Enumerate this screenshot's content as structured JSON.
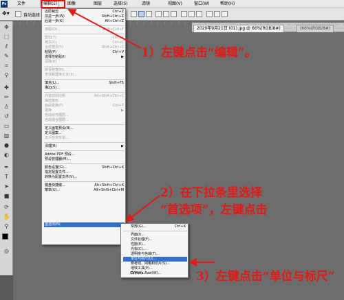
{
  "menubar": {
    "logo": "Ps",
    "items": [
      "文件",
      "编辑(E)",
      "图像",
      "图层",
      "选择(S)",
      "滤镜",
      "视图(V)",
      "窗口(W)",
      "帮助(H)"
    ]
  },
  "options_bar": {
    "auto_select": "自动选择",
    "move_icon": "move-tool-icon"
  },
  "document": {
    "tab_active": "2020年9月21日 (01).jpg @ 66%(RGB/8#)",
    "tab_inactive": "(66%(RGB/8#)"
  },
  "edit_menu": {
    "items": [
      {
        "label": "还原裁剪",
        "shortcut": "Ctrl+Z",
        "disabled": false
      },
      {
        "label": "前进一步(W)",
        "shortcut": "Shift+Ctrl+Z",
        "disabled": false
      },
      {
        "label": "后退一步(K)",
        "shortcut": "Alt+Ctrl+Z",
        "disabled": false
      },
      {
        "label": "渐隐(D)...",
        "shortcut": "Shift+Ctrl+F",
        "disabled": true
      },
      {
        "label": "剪切(T)",
        "shortcut": "Ctrl+X",
        "disabled": true
      },
      {
        "label": "拷贝(C)",
        "shortcut": "Ctrl+C",
        "disabled": true
      },
      {
        "label": "合并拷贝(Y)",
        "shortcut": "Shift+Ctrl+C",
        "disabled": true
      },
      {
        "label": "粘贴(P)",
        "shortcut": "Ctrl+V",
        "disabled": false
      },
      {
        "label": "选择性粘贴(I)",
        "shortcut": "",
        "disabled": false,
        "submenu": true
      },
      {
        "label": "清除(E)",
        "shortcut": "",
        "disabled": true
      },
      {
        "label": "拼写检查(H)...",
        "shortcut": "",
        "disabled": true
      },
      {
        "label": "查找和替换文本(X)...",
        "shortcut": "",
        "disabled": true
      },
      {
        "label": "填充(L)...",
        "shortcut": "Shift+F5",
        "disabled": false
      },
      {
        "label": "描边(S)...",
        "shortcut": "",
        "disabled": false
      },
      {
        "label": "内容识别比例",
        "shortcut": "Alt+Shift+Ctrl+C",
        "disabled": true
      },
      {
        "label": "操控变形",
        "shortcut": "",
        "disabled": true
      },
      {
        "label": "自由变换(F)",
        "shortcut": "Ctrl+T",
        "disabled": true
      },
      {
        "label": "变换",
        "shortcut": "",
        "disabled": true,
        "submenu": true
      },
      {
        "label": "自动对齐图层...",
        "shortcut": "",
        "disabled": true
      },
      {
        "label": "自动混合图层...",
        "shortcut": "",
        "disabled": true
      },
      {
        "label": "定义画笔预设(B)...",
        "shortcut": "",
        "disabled": false
      },
      {
        "label": "定义图案...",
        "shortcut": "",
        "disabled": false
      },
      {
        "label": "定义自定形状...",
        "shortcut": "",
        "disabled": true
      },
      {
        "label": "清理(R)",
        "shortcut": "",
        "disabled": false,
        "submenu": true
      },
      {
        "label": "Adobe PDF 预设...",
        "shortcut": "",
        "disabled": false
      },
      {
        "label": "预设管理器(M)...",
        "shortcut": "",
        "disabled": false
      },
      {
        "label": "颜色设置(G)...",
        "shortcut": "Shift+Ctrl+K",
        "disabled": false
      },
      {
        "label": "指定配置文件...",
        "shortcut": "",
        "disabled": false
      },
      {
        "label": "转换为配置文件(V)...",
        "shortcut": "",
        "disabled": false
      },
      {
        "label": "键盘快捷键...",
        "shortcut": "Alt+Shift+Ctrl+K",
        "disabled": false
      },
      {
        "label": "菜单(U)...",
        "shortcut": "Alt+Shift+Ctrl+M",
        "disabled": false
      },
      {
        "label": "首选项(N)",
        "shortcut": "",
        "disabled": false,
        "submenu": true,
        "highlighted": true
      }
    ]
  },
  "preferences_submenu": {
    "items": [
      {
        "label": "常规(G)...",
        "shortcut": "Ctrl+K"
      },
      {
        "label": "界面(I)...",
        "shortcut": ""
      },
      {
        "label": "文件处理(F)...",
        "shortcut": ""
      },
      {
        "label": "性能(E)...",
        "shortcut": ""
      },
      {
        "label": "光标(C)...",
        "shortcut": ""
      },
      {
        "label": "透明度与色域(T)...",
        "shortcut": ""
      },
      {
        "label": "单位与标尺(U)...",
        "shortcut": "",
        "highlighted": true
      },
      {
        "label": "参考线、网格和切片(S)...",
        "shortcut": ""
      },
      {
        "label": "增效工具(P)...",
        "shortcut": ""
      },
      {
        "label": "文字(Y)...",
        "shortcut": ""
      },
      {
        "label": "Camera Raw(W)...",
        "shortcut": ""
      }
    ]
  },
  "annotations": {
    "step1": "1）左键点击“编辑”。",
    "step2_line1": "2）在下拉条里选择",
    "step2_line2": "“首选项”，左键点击",
    "step3": "3）左键点击“单位与标尺”",
    "color": "#e31a17"
  }
}
